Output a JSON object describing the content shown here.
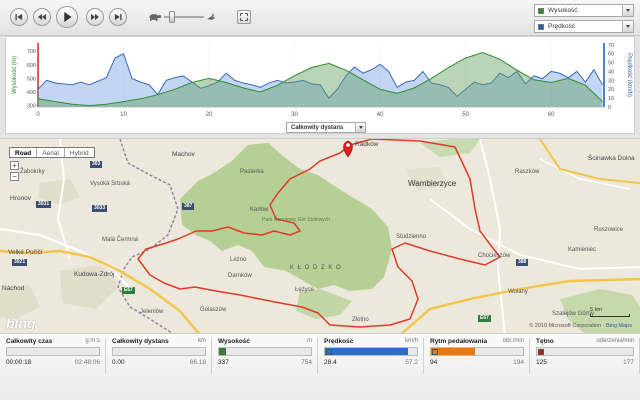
{
  "toolbar": {
    "buttons": [
      "skip-start-icon",
      "rewind-icon",
      "play-icon",
      "fast-forward-icon",
      "skip-end-icon"
    ],
    "speed_slider": {
      "value": 0.2
    },
    "legend_selects": [
      {
        "label": "Wysokość",
        "color": "#2e8b2e"
      },
      {
        "label": "Prędkość",
        "color": "#2a5cb5"
      }
    ]
  },
  "chart_data": {
    "type": "area",
    "xlabel": "Całkowity dystans",
    "x_ticks": [
      "0",
      "10",
      "20",
      "30",
      "40",
      "50",
      "60"
    ],
    "xlim": [
      0,
      66.18
    ],
    "left_axis": {
      "label": "Wysokość (m)",
      "ticks": [
        "300",
        "400",
        "500",
        "600",
        "700"
      ],
      "ylim": [
        290,
        760
      ]
    },
    "right_axis": {
      "label": "Prędkość (km/h)",
      "ticks": [
        "0",
        "10",
        "20",
        "30",
        "40",
        "50",
        "60",
        "70"
      ],
      "ylim": [
        0,
        72
      ]
    },
    "series": [
      {
        "name": "Wysokość",
        "color": "#2e8b2e",
        "x": [
          0,
          2,
          4,
          6,
          8,
          10,
          12,
          14,
          16,
          18,
          20,
          22,
          24,
          26,
          28,
          30,
          32,
          34,
          36,
          38,
          40,
          42,
          44,
          46,
          48,
          50,
          52,
          54,
          56,
          58,
          60,
          62,
          64,
          66
        ],
        "values": [
          350,
          330,
          310,
          300,
          310,
          330,
          350,
          380,
          420,
          470,
          500,
          470,
          430,
          400,
          450,
          520,
          580,
          610,
          560,
          490,
          420,
          390,
          430,
          500,
          580,
          650,
          690,
          640,
          560,
          490,
          470,
          500,
          450,
          330
        ]
      },
      {
        "name": "Prędkość",
        "color": "#2a5cb5",
        "x": [
          0,
          1,
          2,
          3,
          4,
          5,
          6,
          7,
          8,
          9,
          10,
          11,
          12,
          13,
          14,
          15,
          16,
          17,
          18,
          19,
          20,
          21,
          22,
          23,
          24,
          25,
          26,
          27,
          28,
          29,
          30,
          31,
          32,
          33,
          34,
          35,
          36,
          37,
          38,
          39,
          40,
          41,
          42,
          43,
          44,
          45,
          46,
          47,
          48,
          49,
          50,
          51,
          52,
          53,
          54,
          55,
          56,
          57,
          58,
          59,
          60,
          61,
          62,
          63,
          64,
          65,
          66
        ],
        "values": [
          20,
          30,
          27,
          26,
          25,
          28,
          25,
          29,
          33,
          55,
          60,
          32,
          28,
          25,
          14,
          30,
          33,
          35,
          28,
          21,
          24,
          28,
          38,
          30,
          27,
          25,
          22,
          27,
          30,
          27,
          28,
          30,
          26,
          25,
          10,
          20,
          35,
          45,
          38,
          42,
          48,
          40,
          22,
          28,
          30,
          40,
          27,
          25,
          22,
          12,
          20,
          28,
          25,
          27,
          38,
          33,
          40,
          26,
          35,
          32,
          40,
          38,
          33,
          40,
          28,
          42,
          25
        ]
      }
    ]
  },
  "map": {
    "type_buttons": [
      {
        "label": "Road",
        "active": true
      },
      {
        "label": "Aerial",
        "active": false
      },
      {
        "label": "Hybrid",
        "active": false
      }
    ],
    "labels": {
      "machov": "Machov",
      "pasterka": "Pasterka",
      "raszkow_top": "Radków",
      "wambierzyce": "Wambierzyce",
      "raszkow": "Raszków",
      "scinawka": "Ścinawka Dolna",
      "zabokrky": "Žabokrky",
      "vysoka": "Vysoká Srbská",
      "hronov": "Hronov",
      "velke_porici": "Velké Poříčí",
      "mala_cermna": "Malá Čermná",
      "kudowa": "Kudowa-Zdrój",
      "nachod": "Náchod",
      "jelenow": "Jeleniów",
      "karlow": "Karłów",
      "park": "Park Narodowy Gór Stołowych",
      "darnkow": "Darnków",
      "leczyce": "Łężyce",
      "studzienno": "Studzienno",
      "chocieszow": "Chocieszów",
      "wolany": "Wolany",
      "ruszowice": "Ruszowice",
      "kamieniec": "Kamieniec",
      "szalejow": "Szalejów Górny",
      "zlotno": "Złotno",
      "golasow": "Golaszów",
      "klodzko": "K Ł O D Z K O",
      "lezno": "Leżno"
    },
    "roads": {
      "r303": "303",
      "r3031": "3031",
      "r3033": "3033",
      "r387": "387",
      "e67": "E67",
      "r3021": "3021",
      "e67b": "E67",
      "r388": "388"
    },
    "copyright": "© 2010 Microsoft Corporation",
    "copyright_link": "Bing Maps",
    "scale": "5 km",
    "logo": "bing"
  },
  "stats": [
    {
      "name": "Całkowity czas",
      "unit": "g:m:s",
      "value": "00:00:18",
      "max": "02:48:06",
      "color": null,
      "fill": 0.0
    },
    {
      "name": "Całkowity dystans",
      "unit": "km",
      "value": "0.00",
      "max": "66.18",
      "color": null,
      "fill": 0.0
    },
    {
      "name": "Wysokość",
      "unit": "m",
      "value": "337",
      "max": "754",
      "color": "#2e8b2e",
      "fill": 0.08
    },
    {
      "name": "Prędkość",
      "unit": "km/h",
      "value": "28.4",
      "max": "57.2",
      "color": "#2a6ec8",
      "fill": 0.9
    },
    {
      "name": "Rytm pedałowania",
      "unit": "obr./min",
      "value": "94",
      "max": "194",
      "color": "#e07a1a",
      "fill": 0.48
    },
    {
      "name": "Tętno",
      "unit": "uderzenia/min",
      "value": "125",
      "max": "177",
      "color": "#b22222",
      "fill": 0.0
    }
  ]
}
